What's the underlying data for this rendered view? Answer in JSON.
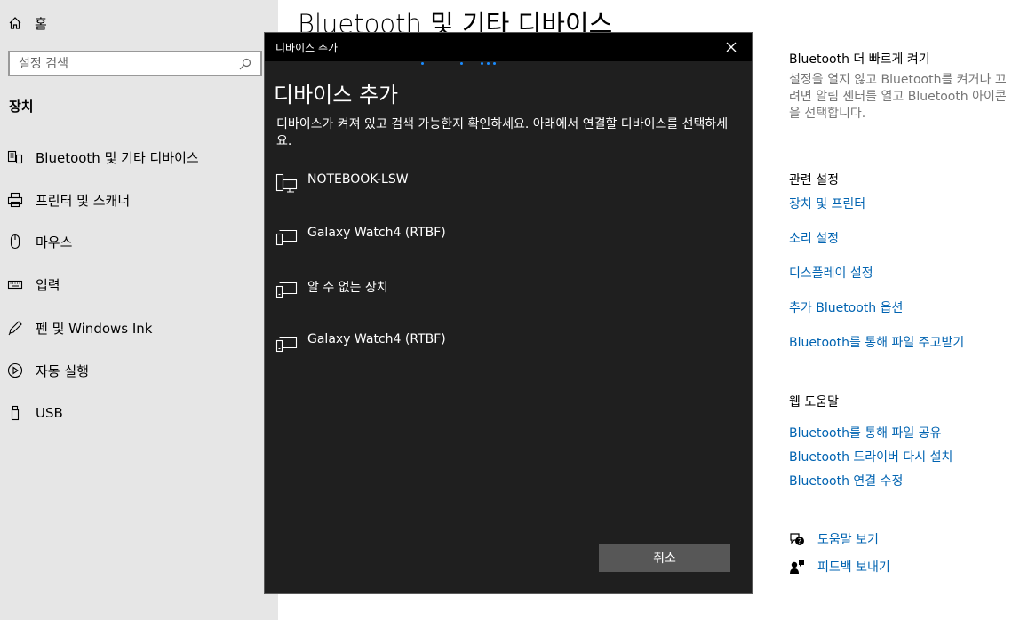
{
  "sidebar": {
    "home_label": "홈",
    "search_placeholder": "설정 검색",
    "section_title": "장치",
    "items": [
      {
        "label": "Bluetooth 및 기타 디바이스",
        "icon": "bluetooth-devices-icon"
      },
      {
        "label": "프린터 및 스캐너",
        "icon": "printer-icon"
      },
      {
        "label": "마우스",
        "icon": "mouse-icon"
      },
      {
        "label": "입력",
        "icon": "keyboard-icon"
      },
      {
        "label": "펜 및 Windows Ink",
        "icon": "pen-icon"
      },
      {
        "label": "자동 실행",
        "icon": "autoplay-icon"
      },
      {
        "label": "USB",
        "icon": "usb-icon"
      }
    ]
  },
  "main": {
    "page_title": "Bluetooth 및 기타 디바이스"
  },
  "right_panel": {
    "quick_title": "Bluetooth 더 빠르게 켜기",
    "quick_text": "설정을 열지 않고 Bluetooth를 켜거나 끄려면 알림 센터를 열고 Bluetooth 아이콘을 선택합니다.",
    "related_title": "관련 설정",
    "related_links": [
      "장치 및 프린터",
      "소리 설정",
      "디스플레이 설정",
      "추가 Bluetooth 옵션",
      "Bluetooth를 통해 파일 주고받기"
    ],
    "web_help_title": "웹 도움말",
    "web_help_links": [
      "Bluetooth를 통해 파일 공유",
      "Bluetooth 드라이버 다시 설치",
      "Bluetooth 연결 수정"
    ],
    "help_label": "도움말 보기",
    "feedback_label": "피드백 보내기"
  },
  "dialog": {
    "window_title": "디바이스 추가",
    "heading": "디바이스 추가",
    "description": "디바이스가 켜져 있고 검색 가능한지 확인하세요. 아래에서 연결할 디바이스를 선택하세요.",
    "devices": [
      {
        "name": "NOTEBOOK-LSW",
        "icon": "computer-icon"
      },
      {
        "name": "Galaxy Watch4 (RTBF)",
        "icon": "device-icon"
      },
      {
        "name": "알 수 없는 장치",
        "icon": "device-icon"
      },
      {
        "name": "Galaxy Watch4 (RTBF)",
        "icon": "device-icon"
      }
    ],
    "cancel_label": "취소"
  },
  "colors": {
    "link": "#0063b1",
    "progress_dots": "#1a8cff",
    "dialog_bg": "#1f1f1f",
    "sidebar_bg": "#e6e6e6"
  }
}
